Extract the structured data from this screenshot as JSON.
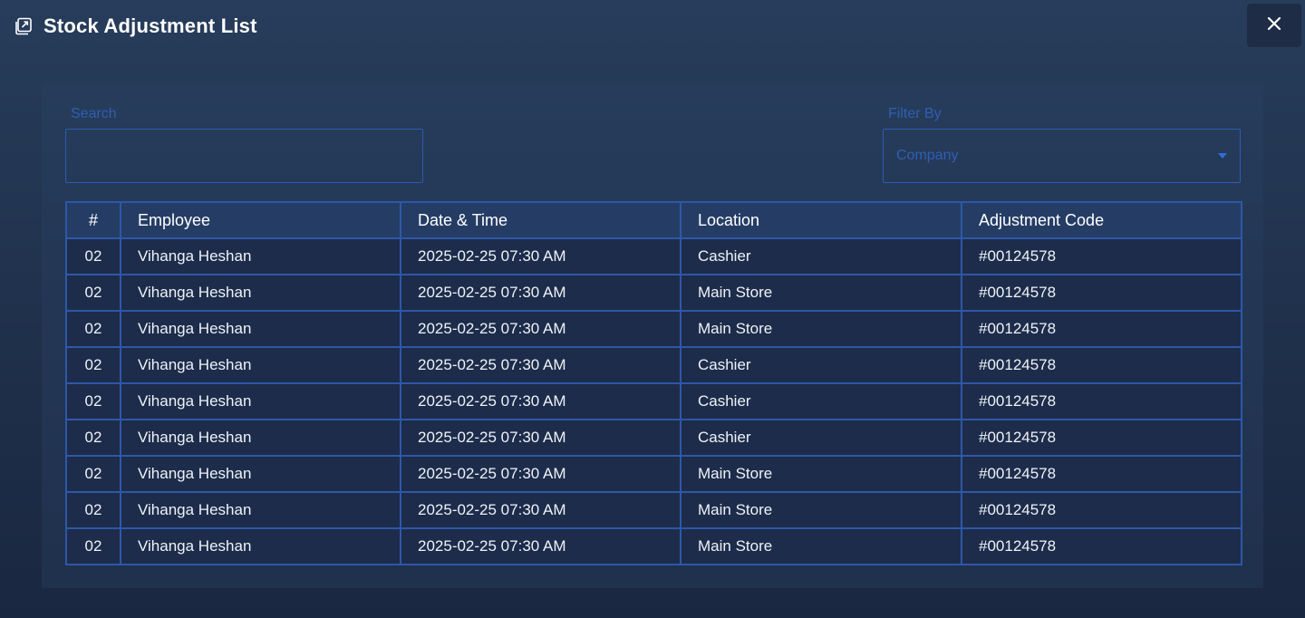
{
  "window": {
    "title": "Stock Adjustment List",
    "title_icon": "external-window-icon",
    "close_icon": "close-x-icon"
  },
  "search": {
    "label": "Search",
    "value": "",
    "placeholder": ""
  },
  "filter": {
    "label": "Filter By",
    "selected": "Company",
    "icon": "caret-down-icon"
  },
  "table": {
    "headers": [
      "#",
      "Employee",
      "Date  & Time",
      "Location",
      "Adjustment Code"
    ],
    "rows": [
      [
        "02",
        "Vihanga Heshan",
        "2025-02-25 07:30 AM",
        "Cashier",
        "#00124578"
      ],
      [
        "02",
        "Vihanga Heshan",
        "2025-02-25 07:30 AM",
        "Main Store",
        "#00124578"
      ],
      [
        "02",
        "Vihanga Heshan",
        "2025-02-25 07:30 AM",
        "Main Store",
        "#00124578"
      ],
      [
        "02",
        "Vihanga Heshan",
        "2025-02-25 07:30 AM",
        "Cashier",
        "#00124578"
      ],
      [
        "02",
        "Vihanga Heshan",
        "2025-02-25 07:30 AM",
        "Cashier",
        "#00124578"
      ],
      [
        "02",
        "Vihanga Heshan",
        "2025-02-25 07:30 AM",
        "Cashier",
        "#00124578"
      ],
      [
        "02",
        "Vihanga Heshan",
        "2025-02-25 07:30 AM",
        "Main Store",
        "#00124578"
      ],
      [
        "02",
        "Vihanga Heshan",
        "2025-02-25 07:30 AM",
        "Main Store",
        "#00124578"
      ],
      [
        "02",
        "Vihanga Heshan",
        "2025-02-25 07:30 AM",
        "Main Store",
        "#00124578"
      ]
    ]
  },
  "colors": {
    "accent": "#2d5bb0",
    "header_bg": "#253d65",
    "row_bg": "#1d2c4a"
  }
}
